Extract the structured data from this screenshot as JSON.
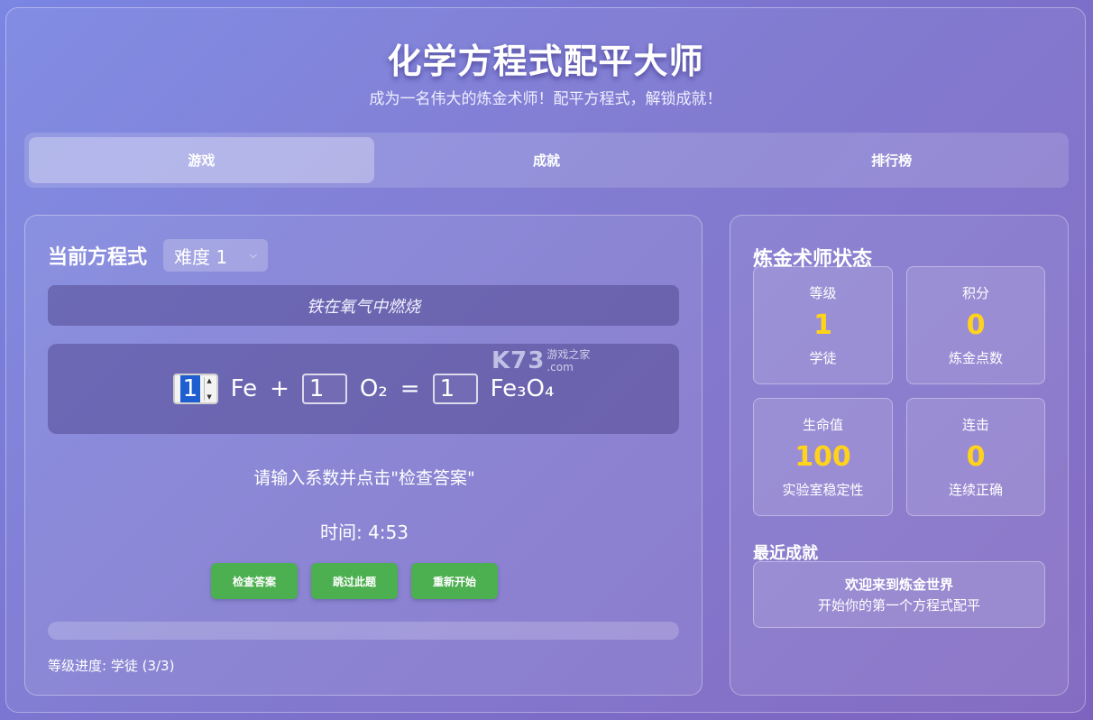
{
  "header": {
    "title": "化学方程式配平大师",
    "subtitle": "成为一名伟大的炼金术师！配平方程式，解锁成就！"
  },
  "tabs": [
    {
      "label": "游戏",
      "active": true
    },
    {
      "label": "成就",
      "active": false
    },
    {
      "label": "排行榜",
      "active": false
    }
  ],
  "game": {
    "heading": "当前方程式",
    "difficulty": "难度 1",
    "description": "铁在氧气中燃烧",
    "equation": {
      "terms": [
        {
          "coefficient": "1",
          "formula": "Fe"
        },
        {
          "coefficient": "1",
          "formula": "O₂"
        },
        {
          "coefficient": "1",
          "formula": "Fe₃O₄"
        }
      ],
      "plus": "+",
      "equals": "="
    },
    "hint": "请输入系数并点击\"检查答案\"",
    "timer": "时间: 4:53",
    "buttons": {
      "check": "检查答案",
      "skip": "跳过此题",
      "restart": "重新开始"
    },
    "progress_fraction": 0,
    "level_progress": "等级进度: 学徒 (3/3)"
  },
  "watermark": {
    "logo": "K73",
    "line1": "游戏之家",
    "line2": ".com"
  },
  "status": {
    "heading": "炼金术师状态",
    "stats": [
      {
        "label": "等级",
        "value": "1",
        "sub": "学徒"
      },
      {
        "label": "积分",
        "value": "0",
        "sub": "炼金点数"
      },
      {
        "label": "生命值",
        "value": "100",
        "sub": "实验室稳定性"
      },
      {
        "label": "连击",
        "value": "0",
        "sub": "连续正确"
      }
    ],
    "recent_heading": "最近成就",
    "recent": {
      "title": "欢迎来到炼金世界",
      "desc": "开始你的第一个方程式配平"
    }
  },
  "colors": {
    "accent_green": "#4caf50",
    "stat_yellow": "#ffd21c",
    "focus_blue": "#1f5ed1"
  }
}
